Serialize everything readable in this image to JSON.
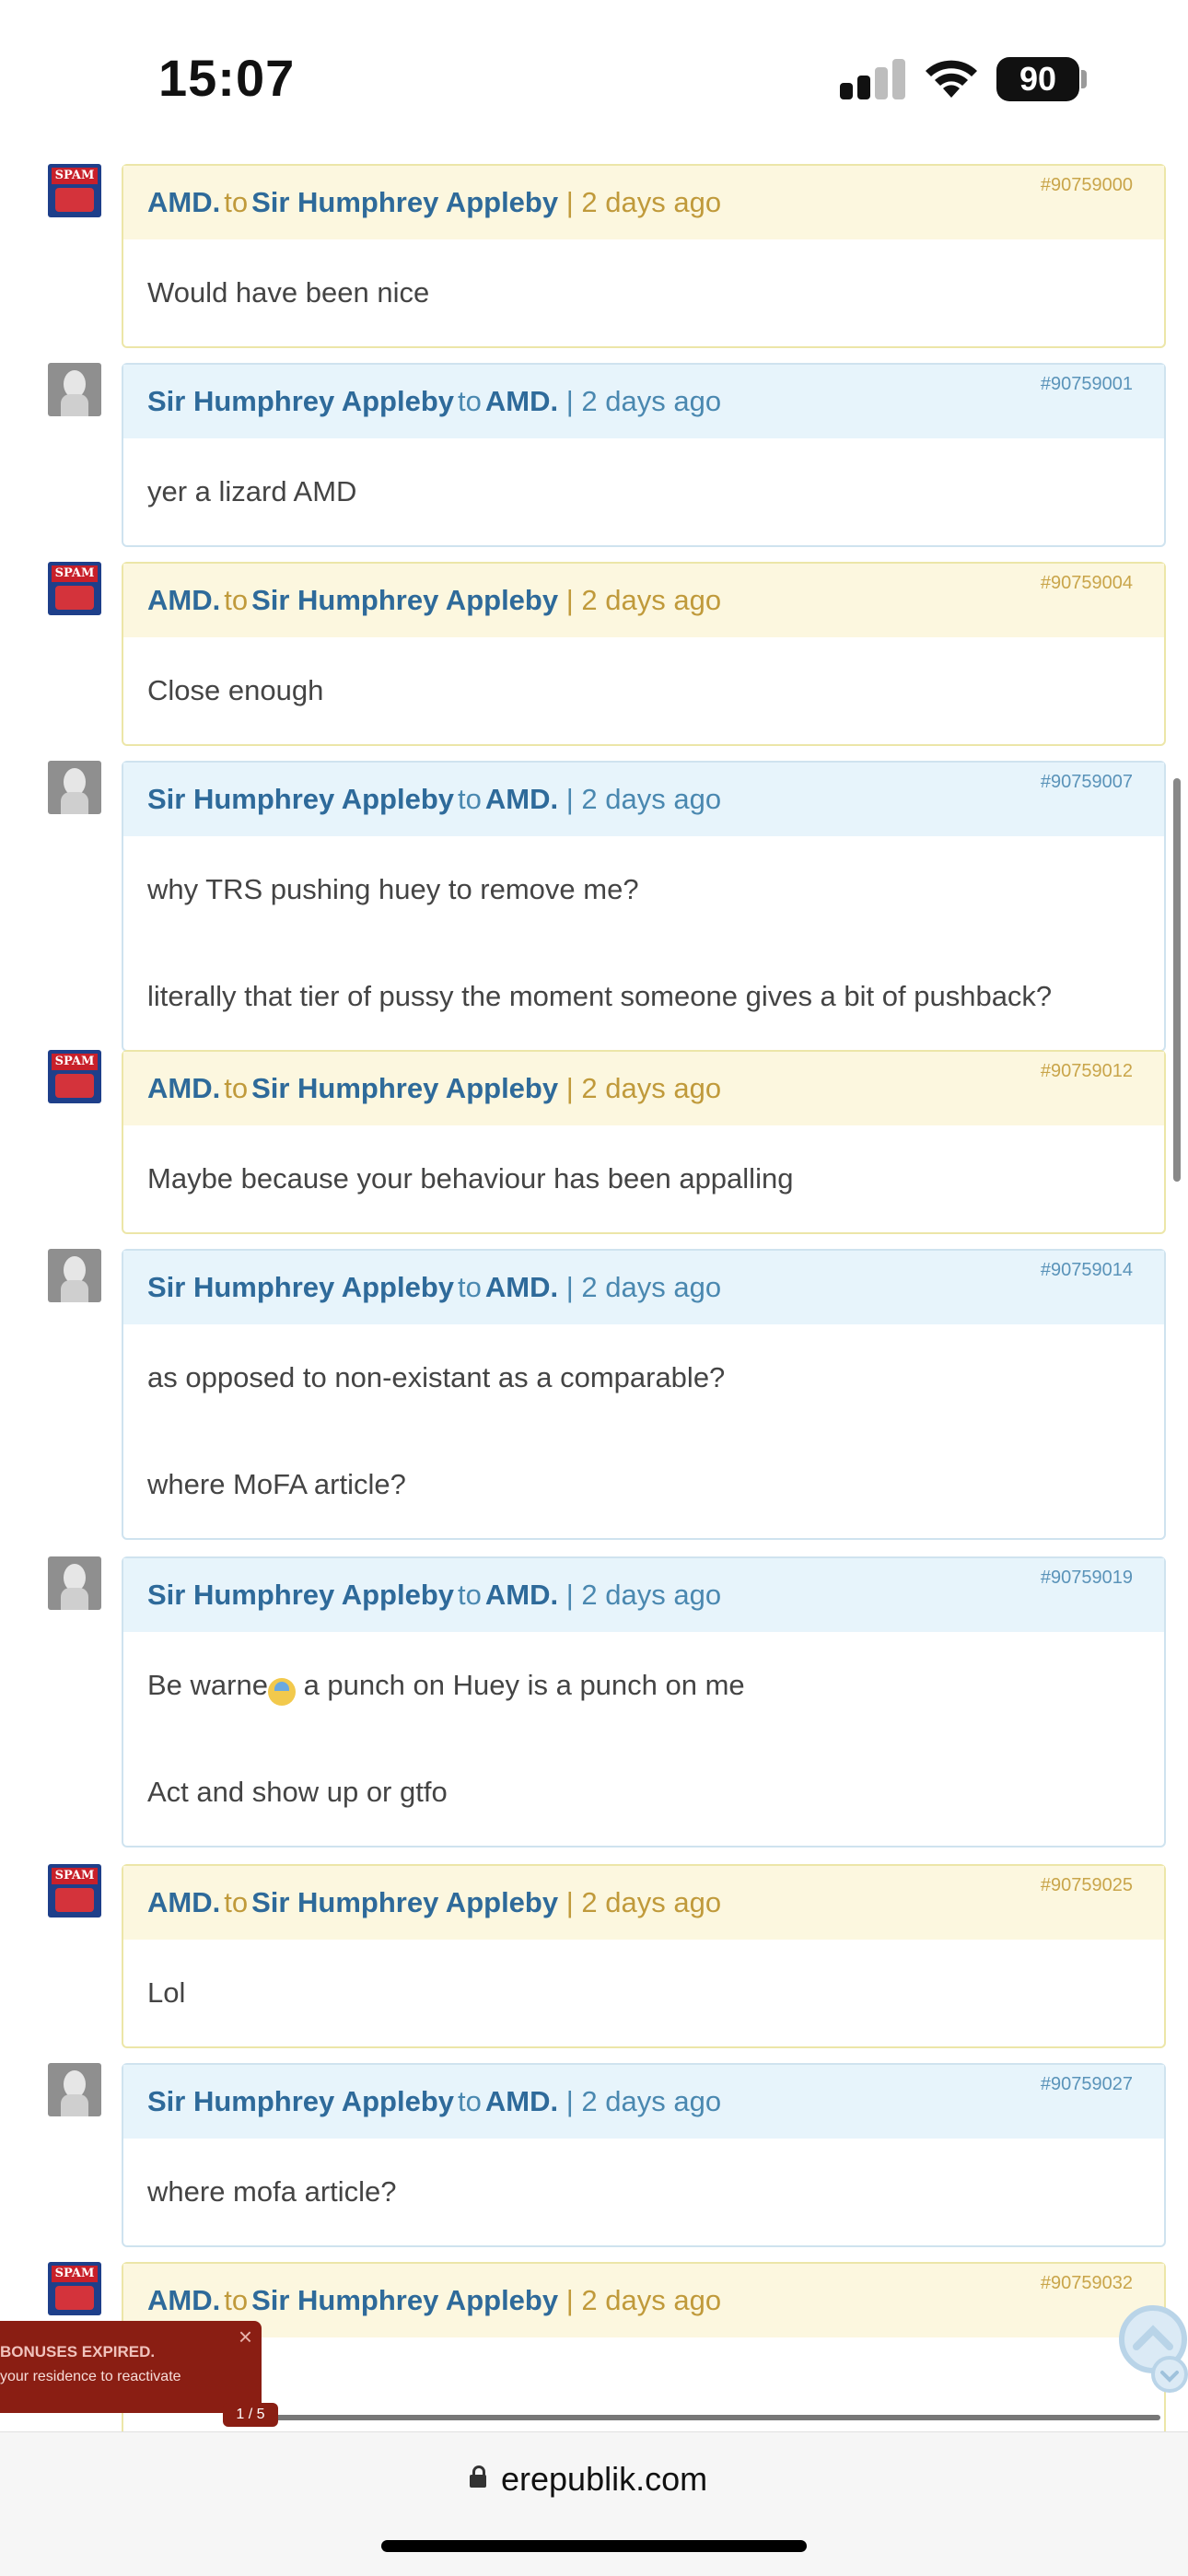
{
  "status_bar": {
    "time": "15:07",
    "battery": "90"
  },
  "messages": [
    {
      "style": "gold",
      "from": "AMD.",
      "to_label": "to",
      "to": "Sir Humphrey Appleby",
      "time": "| 2 days ago",
      "id": "#90759000",
      "lines": [
        "Would have been nice"
      ]
    },
    {
      "style": "blue",
      "from": "Sir Humphrey Appleby",
      "to_label": "to",
      "to": "AMD.",
      "time": "| 2 days ago",
      "id": "#90759001",
      "lines": [
        "yer a lizard AMD"
      ]
    },
    {
      "style": "gold",
      "from": "AMD.",
      "to_label": "to",
      "to": "Sir Humphrey Appleby",
      "time": "| 2 days ago",
      "id": "#90759004",
      "lines": [
        "Close enough"
      ]
    },
    {
      "style": "blue",
      "from": "Sir Humphrey Appleby",
      "to_label": "to",
      "to": "AMD.",
      "time": "| 2 days ago",
      "id": "#90759007",
      "lines": [
        "why TRS pushing huey to remove me?",
        "literally that tier of pussy the moment someone gives a bit of pushback?"
      ]
    },
    {
      "style": "gold",
      "from": "AMD.",
      "to_label": "to",
      "to": "Sir Humphrey Appleby",
      "time": "| 2 days ago",
      "id": "#90759012",
      "lines": [
        "Maybe because your behaviour has been appalling"
      ]
    },
    {
      "style": "blue",
      "from": "Sir Humphrey Appleby",
      "to_label": "to",
      "to": "AMD.",
      "time": "| 2 days ago",
      "id": "#90759014",
      "lines": [
        "as opposed to non-existant as a comparable?",
        "where MoFA article?"
      ]
    },
    {
      "style": "blue",
      "from": "Sir Humphrey Appleby",
      "to_label": "to",
      "to": "AMD.",
      "time": "| 2 days ago",
      "id": "#90759019",
      "lines": [
        "Be warne",
        "Act and show up or gtfo"
      ],
      "line0_after_emoji": " a punch on Huey is a punch on me"
    },
    {
      "style": "gold",
      "from": "AMD.",
      "to_label": "to",
      "to": "Sir Humphrey Appleby",
      "time": "| 2 days ago",
      "id": "#90759025",
      "lines": [
        "Lol"
      ]
    },
    {
      "style": "blue",
      "from": "Sir Humphrey Appleby",
      "to_label": "to",
      "to": "AMD.",
      "time": "| 2 days ago",
      "id": "#90759027",
      "lines": [
        "where mofa article?"
      ]
    },
    {
      "style": "gold",
      "from": "AMD.",
      "to_label": "to",
      "to": "Sir Humphrey Appleby",
      "time": "| 2 days ago",
      "id": "#90759032",
      "lines": []
    }
  ],
  "notification": {
    "title": "BONUSES EXPIRED.",
    "text": "your residence to reactivate",
    "close": "×"
  },
  "pager": "1 / 5",
  "browser": {
    "url": "erepublik.com"
  },
  "icons": {
    "lock": "lock-icon",
    "signal": "cellular-signal-icon",
    "wifi": "wifi-icon",
    "battery": "battery-icon",
    "close": "close-icon",
    "scroll_top": "scroll-to-top-icon"
  },
  "colors": {
    "amd_header": "#fcf7df",
    "humphrey_header": "#e7f4fb",
    "name": "#2e6a9a",
    "notification": "#8a1e13"
  }
}
